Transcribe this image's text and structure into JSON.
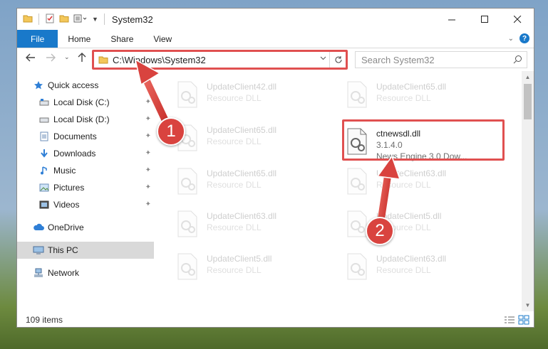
{
  "window": {
    "title": "System32"
  },
  "ribbon": {
    "tabs": [
      "File",
      "Home",
      "Share",
      "View"
    ],
    "help": "?"
  },
  "address": {
    "path": "C:\\Windows\\System32",
    "search_placeholder": "Search System32"
  },
  "sidebar": {
    "items": [
      {
        "label": "Quick access",
        "icon": "star-icon"
      },
      {
        "label": "Local Disk (C:)",
        "icon": "drive-icon",
        "pinned": true
      },
      {
        "label": "Local Disk (D:)",
        "icon": "drive-icon",
        "pinned": true
      },
      {
        "label": "Documents",
        "icon": "documents-icon",
        "pinned": true
      },
      {
        "label": "Downloads",
        "icon": "download-icon",
        "pinned": true
      },
      {
        "label": "Music",
        "icon": "music-icon",
        "pinned": true
      },
      {
        "label": "Pictures",
        "icon": "pictures-icon",
        "pinned": true
      },
      {
        "label": "Videos",
        "icon": "videos-icon",
        "pinned": true
      },
      {
        "label": "OneDrive",
        "icon": "cloud-icon"
      },
      {
        "label": "This PC",
        "icon": "computer-icon",
        "selected": true
      },
      {
        "label": "Network",
        "icon": "network-icon"
      }
    ]
  },
  "files": {
    "left_column": [
      {
        "name": "UpdateClient42.dll",
        "type": "Resource DLL"
      },
      {
        "name": "UpdateClient65.dll",
        "type": "Resource DLL"
      },
      {
        "name": "UpdateClient65.dll",
        "type": "Resource DLL"
      },
      {
        "name": "UpdateClient63.dll",
        "type": "Resource DLL"
      },
      {
        "name": "UpdateClient5.dll",
        "type": "Resource DLL"
      }
    ],
    "right_column": [
      {
        "name": "UpdateClient65.dll",
        "type": "Resource DLL"
      },
      {
        "name": "UpdateClient63.dll",
        "type": "Resource DLL"
      },
      {
        "name": "UpdateClient5.dll",
        "type": "Resource DLL"
      },
      {
        "name": "UpdateClient63.dll",
        "type": "Resource DLL"
      }
    ],
    "highlighted": {
      "name": "ctnewsdl.dll",
      "version": "3.1.4.0",
      "description": "News Engine 3.0 Dow..."
    }
  },
  "status": {
    "item_count": "109 items"
  },
  "callouts": {
    "first": "1",
    "second": "2"
  },
  "colors": {
    "accent": "#1979ca",
    "highlight": "#e05050",
    "callout": "#d9433f"
  }
}
